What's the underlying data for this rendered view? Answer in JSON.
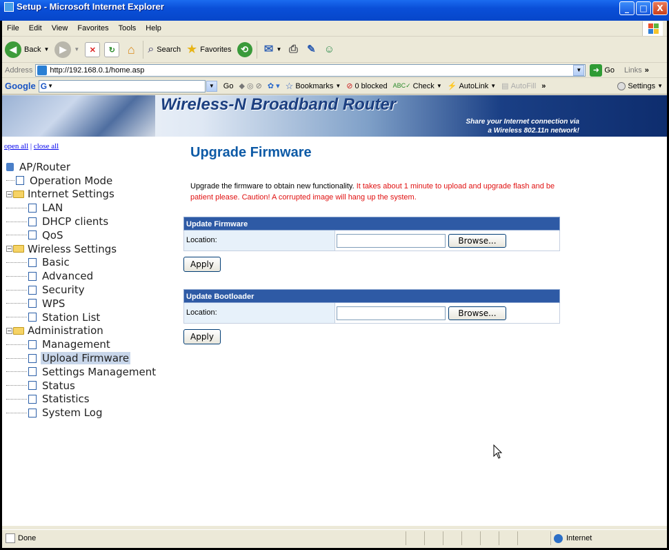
{
  "window": {
    "title": "Setup - Microsoft Internet Explorer",
    "buttons": [
      "_",
      "□",
      "X"
    ]
  },
  "menu": [
    "File",
    "Edit",
    "View",
    "Favorites",
    "Tools",
    "Help"
  ],
  "toolbar": {
    "back": "Back",
    "search": "Search",
    "favorites": "Favorites"
  },
  "address": {
    "label": "Address",
    "url": "http://192.168.0.1/home.asp",
    "go": "Go",
    "links": "Links"
  },
  "googlebar": {
    "logo": "Google",
    "logo_small": "G",
    "go": "Go",
    "bookmarks": "Bookmarks",
    "blocked": "0 blocked",
    "check": "Check",
    "autolink": "AutoLink",
    "autofill": "AutoFill",
    "more": "»",
    "settings": "Settings"
  },
  "banner": {
    "title": "Wireless-N Broadband Router",
    "subtitle_line1": "Share your Internet connection via",
    "subtitle_line2": "a Wireless 802.11n network!"
  },
  "tree": {
    "open_all": "open all",
    "sep": "|",
    "close_all": "close all",
    "nodes": [
      {
        "label": "AP/Router",
        "level": 0,
        "type": "root"
      },
      {
        "label": "Operation Mode",
        "level": 1,
        "type": "page"
      },
      {
        "label": "Internet Settings",
        "level": 0,
        "type": "folder"
      },
      {
        "label": "LAN",
        "level": 2,
        "type": "page"
      },
      {
        "label": "DHCP clients",
        "level": 2,
        "type": "page"
      },
      {
        "label": "QoS",
        "level": 2,
        "type": "page"
      },
      {
        "label": "Wireless Settings",
        "level": 0,
        "type": "folder"
      },
      {
        "label": "Basic",
        "level": 2,
        "type": "page"
      },
      {
        "label": "Advanced",
        "level": 2,
        "type": "page"
      },
      {
        "label": "Security",
        "level": 2,
        "type": "page"
      },
      {
        "label": "WPS",
        "level": 2,
        "type": "page"
      },
      {
        "label": "Station List",
        "level": 2,
        "type": "page"
      },
      {
        "label": "Administration",
        "level": 0,
        "type": "folder"
      },
      {
        "label": "Management",
        "level": 2,
        "type": "page"
      },
      {
        "label": "Upload Firmware",
        "level": 2,
        "type": "page",
        "selected": true
      },
      {
        "label": "Settings Management",
        "level": 2,
        "type": "page"
      },
      {
        "label": "Status",
        "level": 2,
        "type": "page"
      },
      {
        "label": "Statistics",
        "level": 2,
        "type": "page"
      },
      {
        "label": "System Log",
        "level": 2,
        "type": "page"
      }
    ]
  },
  "content": {
    "heading": "Upgrade Firmware",
    "desc_normal": "Upgrade the firmware to obtain new functionality.",
    "desc_warn": " It takes about 1 minute to upload and upgrade flash and be patient please. Caution! A corrupted image will hang up the system.",
    "firmware": {
      "header": "Update Firmware",
      "location_label": "Location:",
      "browse": "Browse...",
      "apply": "Apply"
    },
    "bootloader": {
      "header": "Update Bootloader",
      "location_label": "Location:",
      "browse": "Browse...",
      "apply": "Apply"
    }
  },
  "status": {
    "text": "Done",
    "zone": "Internet"
  }
}
